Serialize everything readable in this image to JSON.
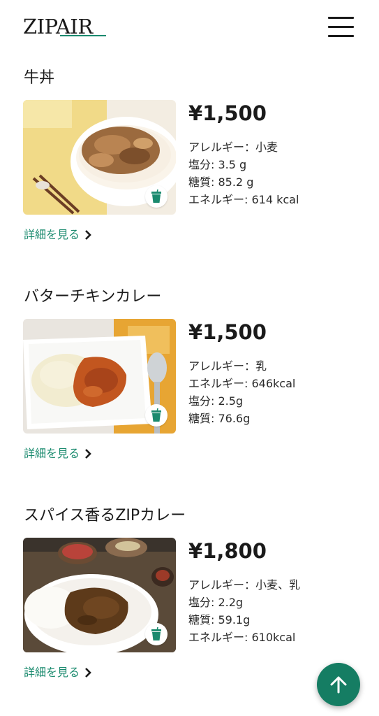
{
  "header": {
    "logo_text": "ZIPAIR",
    "menu_icon": "hamburger-menu-icon"
  },
  "menu_items": [
    {
      "title": "牛丼",
      "price": "¥1,500",
      "facts": [
        "アレルギー：小麦",
        "塩分: 3.5 g",
        "糖質: 85.2 g",
        "エネルギー: 614 kcal"
      ],
      "detail_label": "詳細を見る",
      "image": "gyudon-photo",
      "badge_icon": "drink-cup-icon"
    },
    {
      "title": "バターチキンカレー",
      "price": "¥1,500",
      "facts": [
        "アレルギー：乳",
        "エネルギー: 646kcal",
        "塩分: 2.5g",
        "糖質: 76.6g"
      ],
      "detail_label": "詳細を見る",
      "image": "butter-chicken-curry-photo",
      "badge_icon": "drink-cup-icon"
    },
    {
      "title": "スパイス香るZIPカレー",
      "price": "¥1,800",
      "facts": [
        "アレルギー：小麦、乳",
        "塩分: 2.2g",
        "糖質: 59.1g",
        "エネルギー: 610kcal"
      ],
      "detail_label": "詳細を見る",
      "image": "spice-zip-curry-photo",
      "badge_icon": "drink-cup-icon"
    }
  ],
  "colors": {
    "accent": "#1a8a6e",
    "scroll_top_bg": "#157d63",
    "text": "#1a1a1a"
  },
  "scroll_top_icon": "arrow-up-icon"
}
